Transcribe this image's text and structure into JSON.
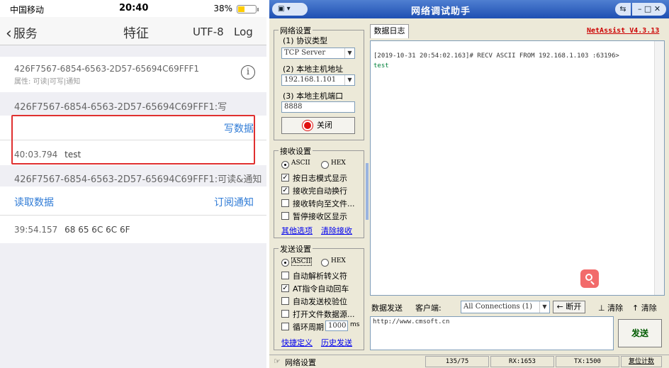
{
  "phone": {
    "status": {
      "carrier": "中国移动",
      "time": "20:40",
      "battery": "38%"
    },
    "nav": {
      "back": "服务",
      "title": "特征",
      "encoding": "UTF-8",
      "log": "Log"
    },
    "char1": {
      "uuid": "426F7567-6854-6563-2D57-65694C69FFF1",
      "props": "属性: 可读|可写|通知"
    },
    "write_section": {
      "header": "426F7567-6854-6563-2D57-65694C69FFF1:写",
      "action": "写数据",
      "log_time": "40:03.794",
      "log_value": "test"
    },
    "read_section": {
      "header": "426F7567-6854-6563-2D57-65694C69FFF1:可读&通知",
      "read": "读取数据",
      "subscribe": "订阅通知",
      "log_time": "39:54.157",
      "log_value": "68 65 6C 6C 6F"
    }
  },
  "netassist": {
    "title": "网络调试助手",
    "version": "NetAssist V4.3.13",
    "net_settings": {
      "label": "网络设置",
      "protocol_label": "(1) 协议类型",
      "protocol_value": "TCP Server",
      "host_label": "(2) 本地主机地址",
      "host_value": "192.168.1.101",
      "port_label": "(3) 本地主机端口",
      "port_value": "8888",
      "close_button": "关闭"
    },
    "recv_settings": {
      "label": "接收设置",
      "ascii": "ASCII",
      "hex": "HEX",
      "opt1": "按日志模式显示",
      "opt2": "接收完自动换行",
      "opt3": "接收转向至文件...",
      "opt4": "暂停接收区显示",
      "more": "其他选项",
      "clear": "清除接收"
    },
    "send_settings": {
      "label": "发送设置",
      "ascii": "ASCII",
      "hex": "HEX",
      "opt1": "自动解析转义符",
      "opt2": "AT指令自动回车",
      "opt3": "自动发送校验位",
      "opt4": "打开文件数据源...",
      "opt5": "循环周期",
      "period": "1000",
      "unit": "ms",
      "shortcut": "快捷定义",
      "history": "历史发送"
    },
    "log": {
      "tab": "数据日志",
      "line1": "[2019-10-31 20:54:02.163]# RECV ASCII FROM 192.168.1.103 :63196>",
      "line2": "test"
    },
    "send_bar": {
      "tab": "数据发送",
      "client_label": "客户端:",
      "client_value": "All Connections (1)",
      "disconnect": "断开",
      "clear1": "清除",
      "clear2": "清除",
      "send_text": "http://www.cmsoft.cn",
      "send_button": "发送"
    },
    "statusbar": {
      "net": "网络设置",
      "count": "135/75",
      "rx": "RX:1653",
      "tx": "TX:1500",
      "reset": "复位计数"
    }
  }
}
